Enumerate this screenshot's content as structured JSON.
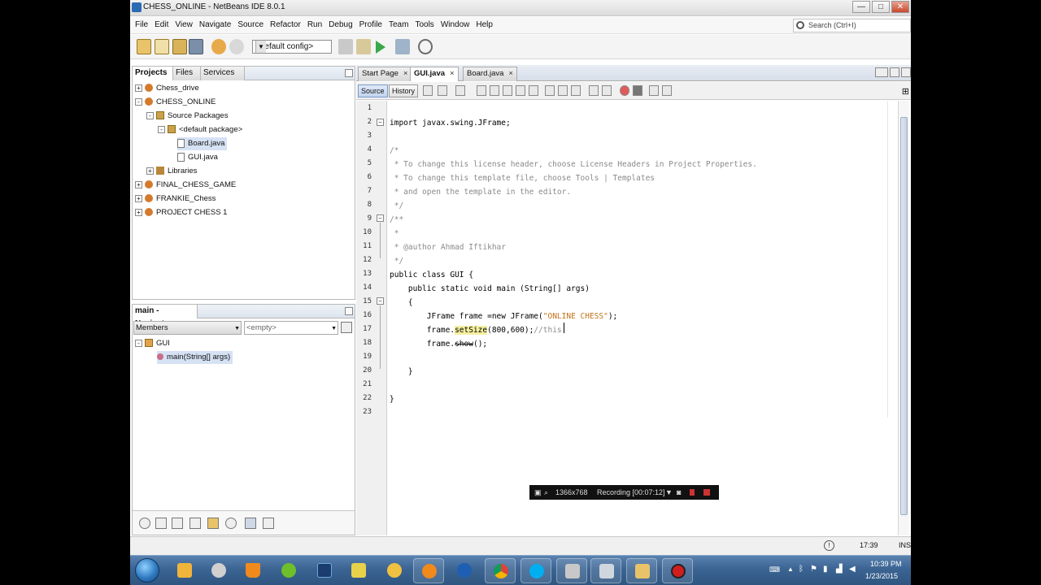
{
  "window": {
    "title": "CHESS_ONLINE - NetBeans IDE 8.0.1",
    "buttons": [
      "—",
      "□",
      "✕"
    ]
  },
  "menu": [
    "File",
    "Edit",
    "View",
    "Navigate",
    "Source",
    "Refactor",
    "Run",
    "Debug",
    "Profile",
    "Team",
    "Tools",
    "Window",
    "Help"
  ],
  "search": {
    "placeholder": "Search (Ctrl+I)"
  },
  "toolbar": {
    "config_value": "<default config>"
  },
  "projects_panel": {
    "tabs": [
      "Projects",
      "Files",
      "Services"
    ],
    "tree": [
      {
        "label": "Chess_drive",
        "toggle": "+"
      },
      {
        "label": "CHESS_ONLINE",
        "toggle": "-"
      },
      {
        "label": "Source Packages",
        "toggle": "-"
      },
      {
        "label": "<default package>",
        "toggle": "-"
      },
      {
        "label": "Board.java"
      },
      {
        "label": "GUI.java"
      },
      {
        "label": "Libraries",
        "toggle": "+"
      },
      {
        "label": "FINAL_CHESS_GAME",
        "toggle": "+"
      },
      {
        "label": "FRANKIE_Chess",
        "toggle": "+"
      },
      {
        "label": "PROJECT CHESS 1",
        "toggle": "+"
      }
    ]
  },
  "navigator": {
    "title": "main - Navigator",
    "members_select": "Members",
    "filter_select": "<empty>",
    "tree": [
      {
        "label": "GUI",
        "toggle": "-"
      },
      {
        "label": "main(String[] args)"
      }
    ]
  },
  "editor": {
    "tabs": [
      "Start Page",
      "GUI.java",
      "Board.java"
    ],
    "active_tab": "GUI.java",
    "view_buttons": [
      "Source",
      "History"
    ],
    "line_numbers": [
      "1",
      "2",
      "3",
      "4",
      "5",
      "6",
      "7",
      "8",
      "9",
      "10",
      "11",
      "12",
      "13",
      "14",
      "15",
      "16",
      "17",
      "18",
      "19",
      "20",
      "21",
      "22",
      "23"
    ],
    "code": {
      "l2": "import javax.swing.JFrame;",
      "l4": "/*",
      "l5": " * To change this license header, choose License Headers in Project Properties.",
      "l6": " * To change this template file, choose Tools | Templates",
      "l7": " * and open the template in the editor.",
      "l8": " */",
      "l9": "/**",
      "l10": " *",
      "l11": " * @author Ahmad Iftikhar",
      "l12": " */",
      "l13": "public class GUI {",
      "l14": "    public static void main (String[] args)",
      "l15": "    {",
      "l16_a": "        JFrame frame =new JFrame(",
      "l16_str": "\"ONLINE CHESS\"",
      "l16_b": ");",
      "l17_a": "        frame.",
      "l17_hl": "setSize",
      "l17_b": "(800,600);",
      "l17_cmt": "//this ",
      "l18_a": "        frame.",
      "l18_strike": "show",
      "l18_b": "();",
      "l20": "    }",
      "l22": "}"
    }
  },
  "recording": {
    "resolution": "1366x768",
    "status": "Recording [00:07:12]"
  },
  "status_bar": {
    "position": "17:39",
    "mode": "INS"
  },
  "taskbar": {
    "time": "10:39 PM",
    "date": "1/23/2015"
  },
  "colors": {
    "accent": "#2f5680",
    "selection": "#d6e2f4",
    "string": "#c2731a",
    "comment": "#8a8a8a"
  }
}
